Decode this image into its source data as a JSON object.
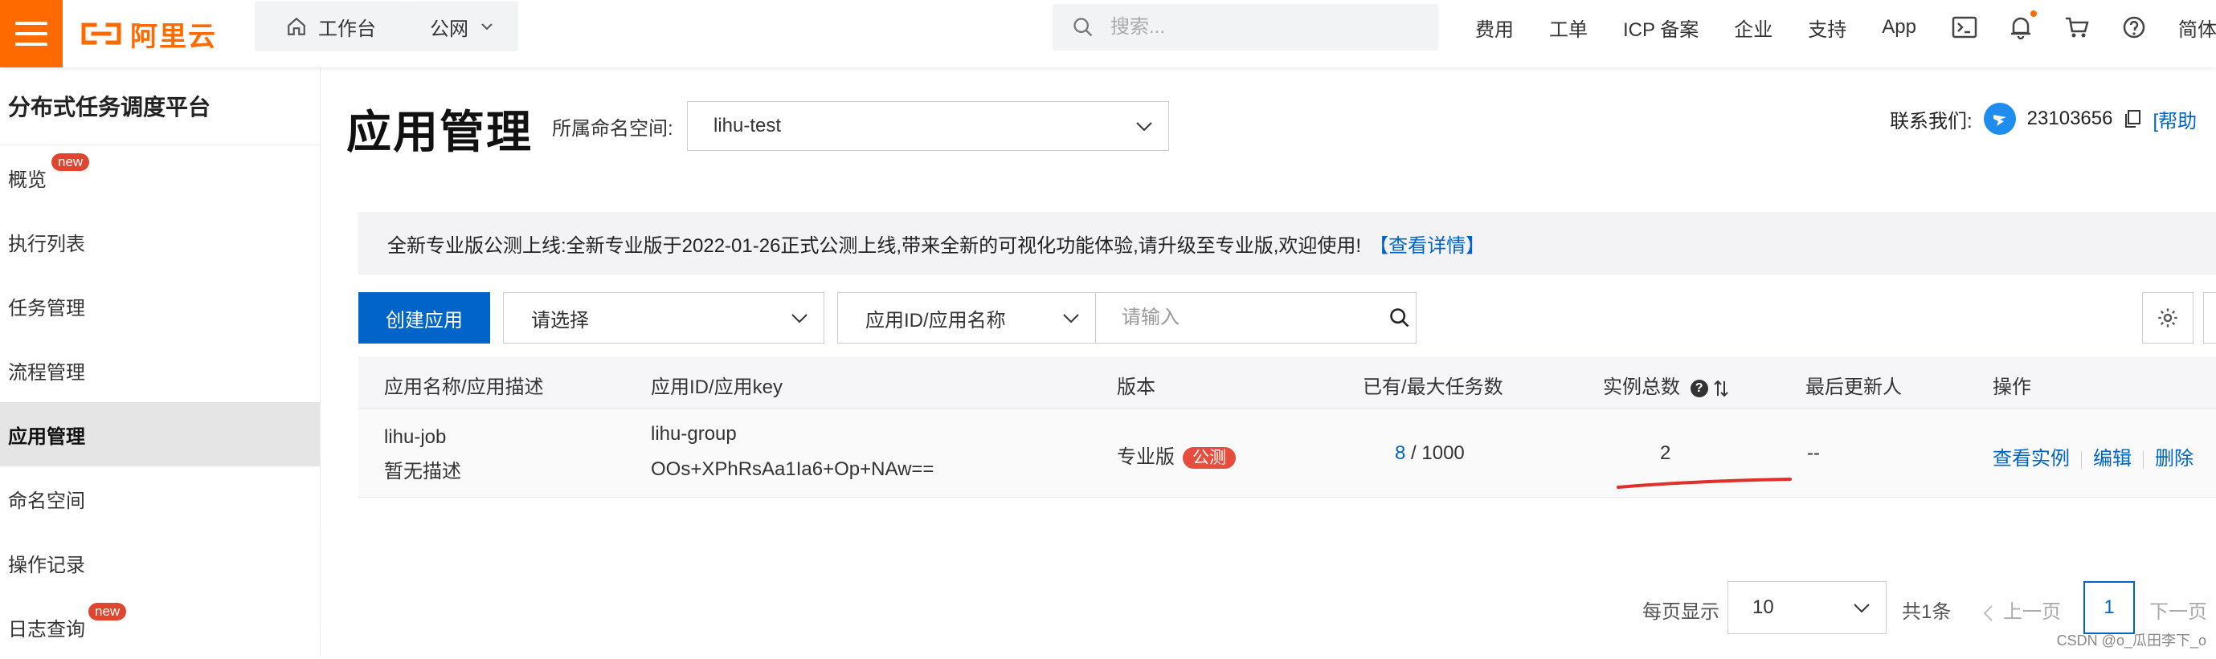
{
  "topbar": {
    "logo_text": "阿里云",
    "workbench": "工作台",
    "network": "公网",
    "search_placeholder": "搜索...",
    "nav": [
      "费用",
      "工单",
      "ICP 备案",
      "企业",
      "支持",
      "App"
    ],
    "language": "简体",
    "brand_color": "#ff6a00"
  },
  "sidebar": {
    "title": "分布式任务调度平台",
    "badge_new": "new",
    "items": [
      {
        "label": "概览",
        "badge": "new"
      },
      {
        "label": "执行列表"
      },
      {
        "label": "任务管理"
      },
      {
        "label": "流程管理"
      },
      {
        "label": "应用管理",
        "active": true
      },
      {
        "label": "命名空间"
      },
      {
        "label": "操作记录"
      },
      {
        "label": "日志查询",
        "badge": "new"
      }
    ]
  },
  "header": {
    "title": "应用管理",
    "namespace_label": "所属命名空间:",
    "namespace_value": "lihu-test",
    "contact_label": "联系我们:",
    "contact_id": "23103656",
    "help_text": "[帮助"
  },
  "notice": {
    "text": "全新专业版公测上线:全新专业版于2022-01-26正式公测上线,带来全新的可视化功能体验,请升级至专业版,欢迎使用!",
    "link": "【查看详情】"
  },
  "toolbar": {
    "create_label": "创建应用",
    "filter_placeholder": "请选择",
    "search_field": "应用ID/应用名称",
    "search_placeholder": "请输入"
  },
  "table": {
    "headers": [
      "应用名称/应用描述",
      "应用ID/应用key",
      "版本",
      "已有/最大任务数",
      "实例总数",
      "最后更新人",
      "操作"
    ],
    "help_mark": "?",
    "rows": [
      {
        "name": "lihu-job",
        "desc": "暂无描述",
        "app_id": "lihu-group",
        "app_key": "OOs+XPhRsAa1Ia6+Op+NAw==",
        "version": "专业版",
        "version_tag": "公测",
        "tasks_current": "8",
        "tasks_max": "/ 1000",
        "instances": "2",
        "updated_by": "--",
        "actions": [
          "查看实例",
          "编辑",
          "删除"
        ]
      }
    ]
  },
  "pagination": {
    "per_page_label": "每页显示",
    "per_page": "10",
    "total": "共1条",
    "prev": "上一页",
    "current": "1",
    "next": "下一页"
  },
  "watermark": "CSDN @o_瓜田李下_o",
  "accent_color": "#0064c8"
}
